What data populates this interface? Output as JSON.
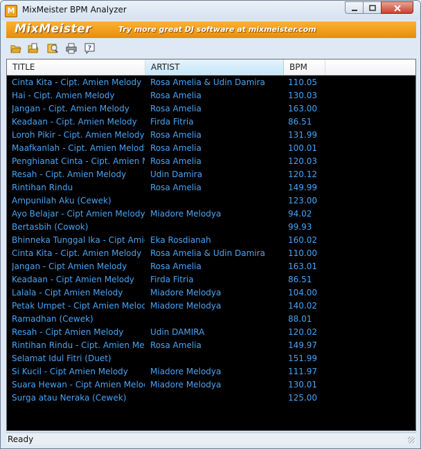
{
  "window": {
    "title": "MixMeister BPM Analyzer",
    "app_icon_letter": "M"
  },
  "banner": {
    "logo": "MixMeister",
    "tagline": "Try more great DJ software at mixmeister.com"
  },
  "toolbar": {
    "icons": [
      "open-folder-icon",
      "open-files-icon",
      "analyze-icon",
      "print-icon",
      "help-icon"
    ]
  },
  "colors": {
    "row_text": "#49a4f5",
    "list_bg": "#000000",
    "banner": "#f5a21a"
  },
  "table": {
    "columns": [
      "TITLE",
      "ARTIST",
      "BPM"
    ],
    "rows": [
      {
        "title": "Cinta Kita - Cipt. Amien Melody",
        "artist": "Rosa Amelia & Udin Damira",
        "bpm": "110.05"
      },
      {
        "title": "Hai - Cipt. Amien Melody",
        "artist": "Rosa Amelia",
        "bpm": "130.03"
      },
      {
        "title": "Jangan - Cipt. Amien Melody",
        "artist": "Rosa Amelia",
        "bpm": "163.00"
      },
      {
        "title": "Keadaan - Cipt. Amien Melody",
        "artist": "Firda Fitria",
        "bpm": "86.51"
      },
      {
        "title": "Loroh Pikir - Cipt. Amien Melody",
        "artist": "Rosa Amelia",
        "bpm": "131.99"
      },
      {
        "title": "Maafkanlah - Cipt. Amien Melody",
        "artist": "Rosa Amelia",
        "bpm": "100.01"
      },
      {
        "title": "Penghianat Cinta - Cipt. Amien M...",
        "artist": "Rosa Amelia",
        "bpm": "120.03"
      },
      {
        "title": "Resah - Cipt. Amien Melody",
        "artist": "Udin Damira",
        "bpm": "120.12"
      },
      {
        "title": "Rintihan Rindu",
        "artist": "Rosa Amelia",
        "bpm": "149.99"
      },
      {
        "title": "Ampunilah Aku (Cewek)",
        "artist": "",
        "bpm": "123.00"
      },
      {
        "title": "Ayo Belajar - Cipt Amien Melody",
        "artist": "Miadore Melodya",
        "bpm": "94.02"
      },
      {
        "title": "Bertasbih (Cowok)",
        "artist": "",
        "bpm": "99.93"
      },
      {
        "title": "Bhinneka Tunggal Ika - Cipt Amie...",
        "artist": "Eka Rosdianah",
        "bpm": "160.02"
      },
      {
        "title": "Cinta Kita - Cipt. Amien Melody",
        "artist": "Rosa Amelia & Udin Damira",
        "bpm": "110.00"
      },
      {
        "title": "Jangan - Cipt Amien Melody",
        "artist": "Rosa Amelia",
        "bpm": "163.01"
      },
      {
        "title": "Keadaan - Cipt Amien Melody",
        "artist": "Firda Fitria",
        "bpm": "86.51"
      },
      {
        "title": "Lalala - Cipt Amien Melody",
        "artist": "Miadore Melodya",
        "bpm": "104.00"
      },
      {
        "title": "Petak Umpet - Cipt Amien Melody",
        "artist": "Miadore Melodya",
        "bpm": "140.02"
      },
      {
        "title": "Ramadhan (Cewek)",
        "artist": "",
        "bpm": "88.01"
      },
      {
        "title": "Resah - Cipt Amien Melody",
        "artist": "Udin DAMIRA",
        "bpm": "120.02"
      },
      {
        "title": "Rintihan Rindu - Cipt. Amien Melo...",
        "artist": "Rosa Amelia",
        "bpm": "149.97"
      },
      {
        "title": "Selamat Idul Fitri (Duet)",
        "artist": "",
        "bpm": "151.99"
      },
      {
        "title": "Si Kucil - Cipt Amien Melody",
        "artist": "Miadore Melodya",
        "bpm": "111.97"
      },
      {
        "title": "Suara Hewan - Cipt Amien Melody",
        "artist": "Miadore Melodya",
        "bpm": "130.01"
      },
      {
        "title": "Surga atau Neraka (Cewek)",
        "artist": "",
        "bpm": "125.00"
      }
    ]
  },
  "status": {
    "text": "Ready"
  }
}
